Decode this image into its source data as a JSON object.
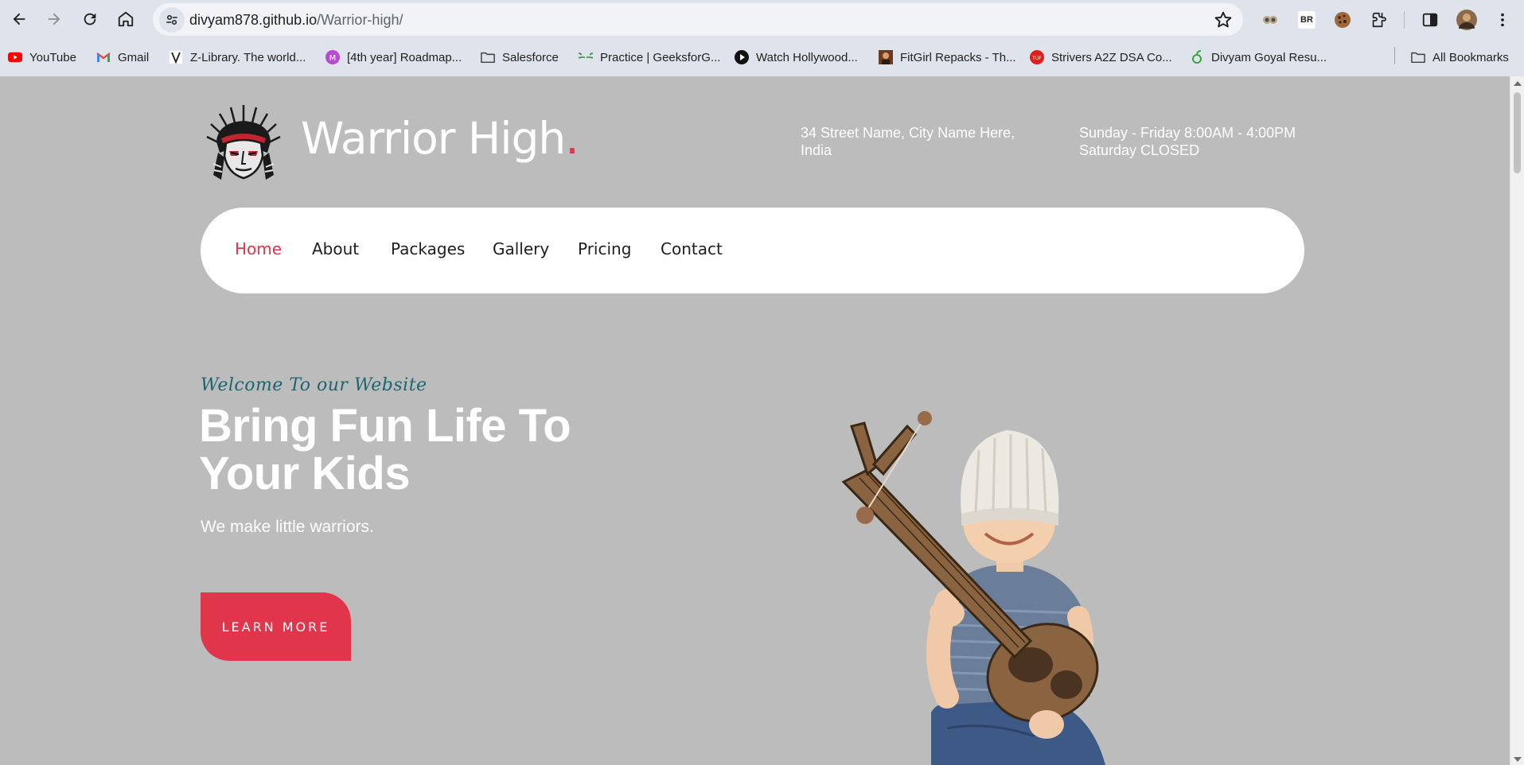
{
  "browser": {
    "url_host": "divyam878.github.io",
    "url_path": "/Warrior-high/",
    "bookmarks": [
      {
        "label": "YouTube",
        "icon": "youtube-icon"
      },
      {
        "label": "Gmail",
        "icon": "gmail-icon"
      },
      {
        "label": "Z-Library. The world...",
        "icon": "zlibrary-icon"
      },
      {
        "label": "[4th year] Roadmap...",
        "icon": "roadmap-icon"
      },
      {
        "label": "Salesforce",
        "icon": "folder-icon"
      },
      {
        "label": "Practice | GeeksforG...",
        "icon": "geeksforgeeks-icon"
      },
      {
        "label": "Watch Hollywood...",
        "icon": "play-icon"
      },
      {
        "label": "FitGirl Repacks - Th...",
        "icon": "fitgirl-icon"
      },
      {
        "label": "Strivers A2Z DSA Co...",
        "icon": "takeuforward-icon"
      },
      {
        "label": "Divyam Goyal Resu...",
        "icon": "resume-icon"
      }
    ],
    "all_bookmarks_label": "All Bookmarks",
    "badge_br": "BR"
  },
  "site": {
    "brand_name": "Warrior High",
    "brand_dot": ".",
    "address_line1": "34 Street Name, City Name Here,",
    "address_line2": "India",
    "hours_line1": "Sunday - Friday 8:00AM - 4:00PM",
    "hours_line2": "Saturday CLOSED",
    "nav": [
      "Home",
      "About",
      "Packages",
      "Gallery",
      "Pricing",
      "Contact"
    ],
    "active_nav": "Home"
  },
  "hero": {
    "welcome": "Welcome To our Website",
    "headline_line1": "Bring Fun Life To",
    "headline_line2": "Your Kids",
    "tagline": "We make little warriors.",
    "cta": "LEARN MORE"
  },
  "colors": {
    "accent": "#e0354b",
    "page_bg": "#bcbcbc",
    "welcome_text": "#1d6670"
  }
}
